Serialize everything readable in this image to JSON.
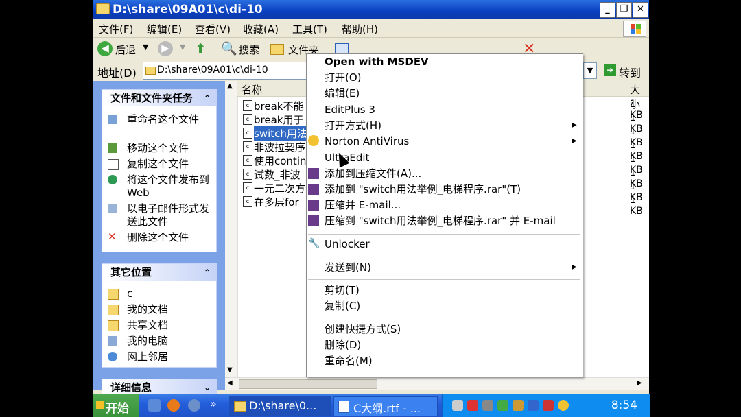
{
  "window": {
    "title": "D:\\share\\09A01\\c\\di-10",
    "min_label": "_",
    "max_label": "❐",
    "close_label": "✕"
  },
  "menubar": [
    "文件(F)",
    "编辑(E)",
    "查看(V)",
    "收藏(A)",
    "工具(T)",
    "帮助(H)"
  ],
  "toolbar": {
    "back": "后退",
    "search": "搜索",
    "folders": "文件夹"
  },
  "address": {
    "label": "地址(D)",
    "value": "D:\\share\\09A01\\c\\di-10",
    "go": "转到"
  },
  "tasks": {
    "title": "文件和文件夹任务",
    "items": [
      "重命名这个文件",
      "移动这个文件",
      "复制这个文件",
      "将这个文件发布到 Web",
      "以电子邮件形式发送此文件",
      "删除这个文件"
    ]
  },
  "places": {
    "title": "其它位置",
    "items": [
      "c",
      "我的文档",
      "共享文档",
      "我的电脑",
      "网上邻居"
    ]
  },
  "details": {
    "title": "详细信息"
  },
  "columns": {
    "name": "名称",
    "size": "大小"
  },
  "files": [
    {
      "name": "break不能",
      "size": "1 KB",
      "selected": false
    },
    {
      "name": "break用于",
      "size": "1 KB",
      "selected": false
    },
    {
      "name": "switch用法",
      "size": "1 KB",
      "selected": true
    },
    {
      "name": "非波拉契序",
      "size": "1 KB",
      "selected": false
    },
    {
      "name": "使用contin",
      "size": "1 KB",
      "selected": false
    },
    {
      "name": "试数_非波",
      "size": "1 KB",
      "selected": false
    },
    {
      "name": "一元二次方",
      "size": "1 KB",
      "selected": false
    },
    {
      "name": "在多层for",
      "size": "1 KB",
      "selected": false
    }
  ],
  "context_menu": [
    "Open with MSDEV",
    "打开(O)",
    "编辑(E)",
    "EditPlus 3",
    "打开方式(H)",
    "Norton AntiVirus",
    "UltraEdit",
    "添加到压缩文件(A)...",
    "添加到 \"switch用法举例_电梯程序.rar\"(T)",
    "压缩并 E-mail...",
    "压缩到 \"switch用法举例_电梯程序.rar\" 并 E-mail",
    "Unlocker",
    "发送到(N)",
    "剪切(T)",
    "复制(C)",
    "创建快捷方式(S)",
    "删除(D)",
    "重命名(M)"
  ],
  "taskbar": {
    "start": "开始",
    "items": [
      "D:\\share\\0...",
      "C大纲.rtf - ..."
    ],
    "clock": "8:54"
  },
  "colors": {
    "selection": "#316ac5",
    "titlebar": "#0a3fc0",
    "taskpane": "#7ba2e7"
  }
}
